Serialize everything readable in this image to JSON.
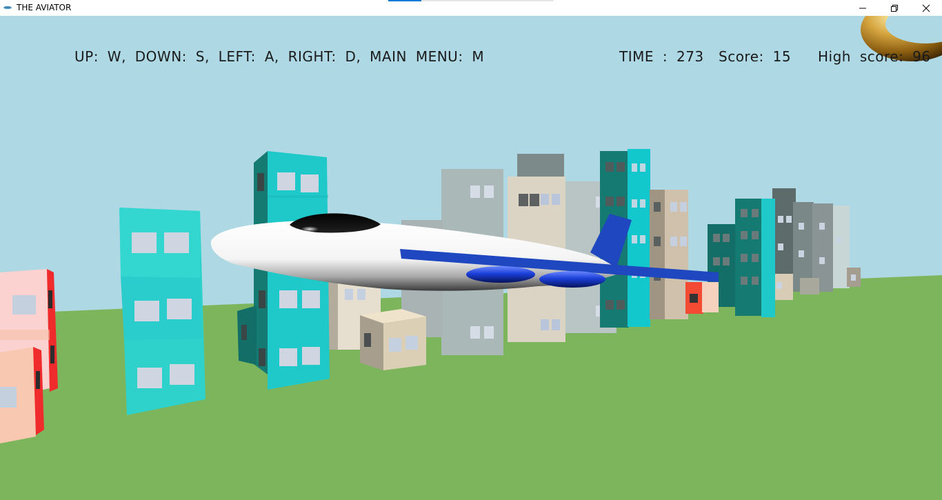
{
  "window": {
    "title": "THE AVIATOR",
    "app_icon": "aviator-app-icon",
    "controls": [
      "minimize-icon",
      "maximize-icon",
      "close-icon"
    ]
  },
  "hud": {
    "controls_text": "UP: W, DOWN: S, LEFT: A, RIGHT: D, MAIN MENU: M",
    "time_label": "TIME :",
    "time_value": "273",
    "score_label": "Score:",
    "score_value": "15",
    "high_score_label": "High score:",
    "high_score_value": "96"
  },
  "colors": {
    "sky": "#add8e4",
    "ground": "#7db55c",
    "plane_body": "#ffffff",
    "plane_accent": "#1e47c0",
    "ring": "#c99a2e"
  }
}
